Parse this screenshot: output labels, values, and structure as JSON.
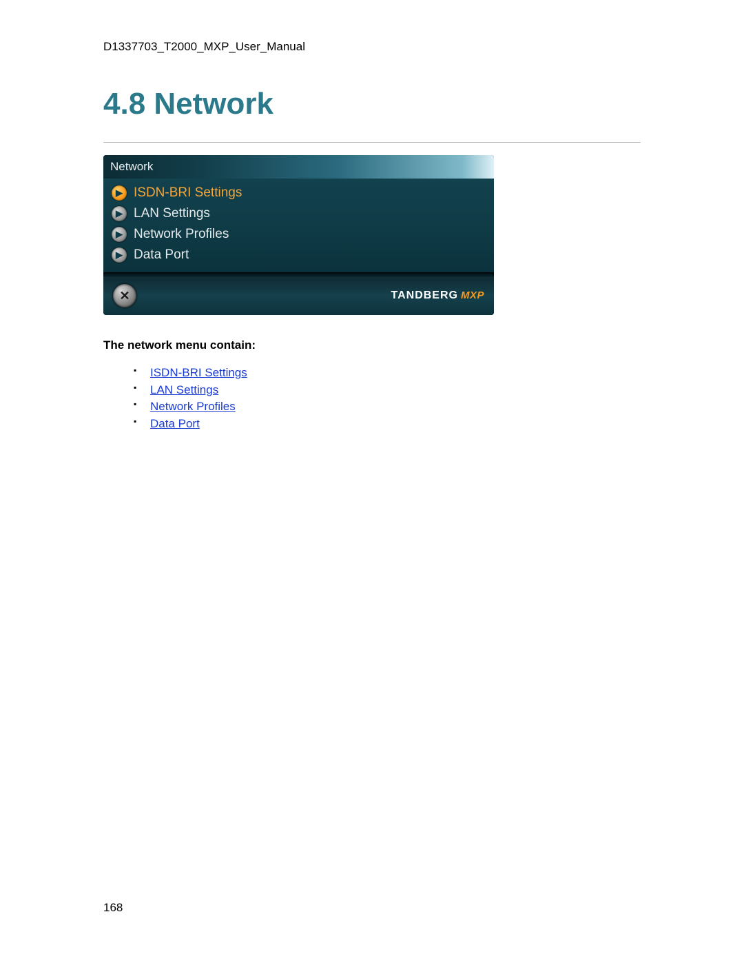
{
  "doc": {
    "header": "D1337703_T2000_MXP_User_Manual",
    "heading": "4.8 Network",
    "page_number": "168"
  },
  "screenshot": {
    "title": "Network",
    "items": [
      {
        "label": "ISDN-BRI Settings",
        "active": true
      },
      {
        "label": "LAN Settings",
        "active": false
      },
      {
        "label": "Network Profiles",
        "active": false
      },
      {
        "label": "Data Port",
        "active": false
      }
    ],
    "close_glyph": "✕",
    "brand_main": "TANDBERG",
    "brand_sub": "MXP"
  },
  "body": {
    "lead": "The network menu contain:",
    "links": [
      "ISDN-BRI Settings",
      "LAN Settings",
      "Network Profiles",
      "Data Port"
    ]
  }
}
